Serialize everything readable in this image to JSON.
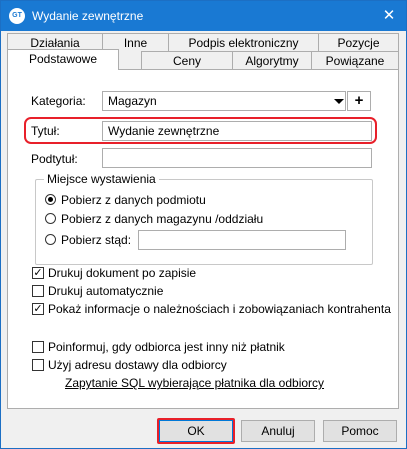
{
  "window": {
    "title": "Wydanie zewnętrzne",
    "app_icon_text": "GT",
    "close_glyph": "✕"
  },
  "tabs_row1": [
    "Działania",
    "Inne",
    "Podpis elektroniczny",
    "Pozycje"
  ],
  "tabs_row2": [
    "Podstawowe",
    "Ceny",
    "Algorytmy",
    "Powiązane"
  ],
  "active_tab": "Podstawowe",
  "form": {
    "kategoria_label": "Kategoria:",
    "kategoria_value": "Magazyn",
    "kategoria_add": "+",
    "tytul_label": "Tytuł:",
    "tytul_value": "Wydanie zewnętrzne",
    "podtytul_label": "Podtytuł:",
    "podtytul_value": ""
  },
  "miejsce": {
    "title": "Miejsce wystawienia",
    "options": [
      "Pobierz z danych podmiotu",
      "Pobierz z danych magazynu /oddziału",
      "Pobierz stąd:"
    ],
    "selected": "Pobierz z danych podmiotu",
    "stad_value": ""
  },
  "checks": [
    {
      "label": "Drukuj dokument po zapisie",
      "checked": true
    },
    {
      "label": "Drukuj automatycznie",
      "checked": false
    },
    {
      "label": "Pokaż informacje o należnościach i zobowiązaniach kontrahenta",
      "checked": true
    },
    {
      "label": "Poinformuj, gdy odbiorca jest inny niż płatnik",
      "checked": false
    },
    {
      "label": "Użyj adresu dostawy dla odbiorcy",
      "checked": false
    }
  ],
  "check_glyph": "✓",
  "sql_link": "Zapytanie SQL wybierające płatnika dla odbiorcy",
  "buttons": {
    "ok": "OK",
    "cancel": "Anuluj",
    "help": "Pomoc"
  },
  "colors": {
    "titlebar": "#1979d3",
    "highlight": "#e8202a"
  }
}
